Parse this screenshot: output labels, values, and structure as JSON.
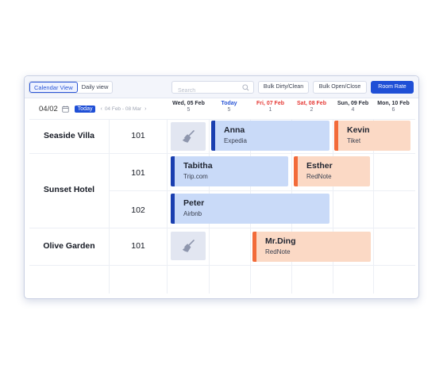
{
  "toolbar": {
    "calendar_view": "Calendar View",
    "daily_view": "Daily view",
    "search_placeholder": "Search",
    "bulk_dirty_clean": "Bulk Dirty/Clean",
    "bulk_open_close": "Bulk Open/Close",
    "room_rate": "Room Rate"
  },
  "datebar": {
    "current_date": "04/02",
    "today_label": "Today",
    "prev_arrow": "‹",
    "next_arrow": "›",
    "range": "04 Feb - 08 Mar"
  },
  "days": [
    {
      "name": "Wed, 05 Feb",
      "num": "5"
    },
    {
      "name": "Today",
      "num": "5"
    },
    {
      "name": "Fri, 07 Feb",
      "num": "1"
    },
    {
      "name": "Sat, 08 Feb",
      "num": "2"
    },
    {
      "name": "Sun, 09 Feb",
      "num": "4"
    },
    {
      "name": "Mon, 10 Feb",
      "num": "6"
    }
  ],
  "hotels": [
    {
      "name": "Seaside Villa",
      "rooms": [
        "101"
      ]
    },
    {
      "name": "Sunset Hotel",
      "rooms": [
        "101",
        "102"
      ]
    },
    {
      "name": "Olive Garden",
      "rooms": [
        "101"
      ]
    }
  ],
  "bookings": [
    {
      "guest": "Anna",
      "source": "Expedia"
    },
    {
      "guest": "Kevin",
      "source": "Tiket"
    },
    {
      "guest": "Tabitha",
      "source": "Trip.com"
    },
    {
      "guest": "Esther",
      "source": "RedNote"
    },
    {
      "guest": "Peter",
      "source": "Airbnb"
    },
    {
      "guest": "Mr.Ding",
      "source": "RedNote"
    }
  ],
  "colors": {
    "accent": "#1f4fd6",
    "today": "#2a56d6",
    "weekend": "#e53935",
    "booking_blue": "#c9daf8",
    "booking_blue_bar": "#1a3fb0",
    "booking_orange": "#fbd9c5",
    "booking_orange_bar": "#f26b3a"
  },
  "icons": {
    "search": "search-icon",
    "calendar": "calendar-icon",
    "cleaning": "broom-icon"
  }
}
